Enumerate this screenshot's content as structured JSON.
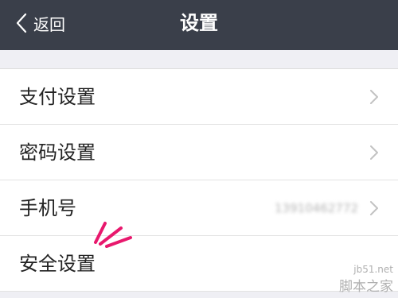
{
  "navbar": {
    "back_label": "返回",
    "title": "设置"
  },
  "settings": {
    "items": [
      {
        "label": "支付设置",
        "value": ""
      },
      {
        "label": "密码设置",
        "value": ""
      },
      {
        "label": "手机号",
        "value": "13910462772"
      },
      {
        "label": "安全设置",
        "value": ""
      }
    ]
  },
  "watermark": {
    "url": "jb51.net",
    "brand": "脚本之家"
  },
  "colors": {
    "navbar_bg": "#3a3f4a",
    "page_bg": "#efeff4",
    "annotation_accent": "#e8186d"
  },
  "icons": {
    "back": "chevron-left-icon",
    "row": "chevron-right-icon",
    "annotation": "emphasis-lines-icon"
  }
}
